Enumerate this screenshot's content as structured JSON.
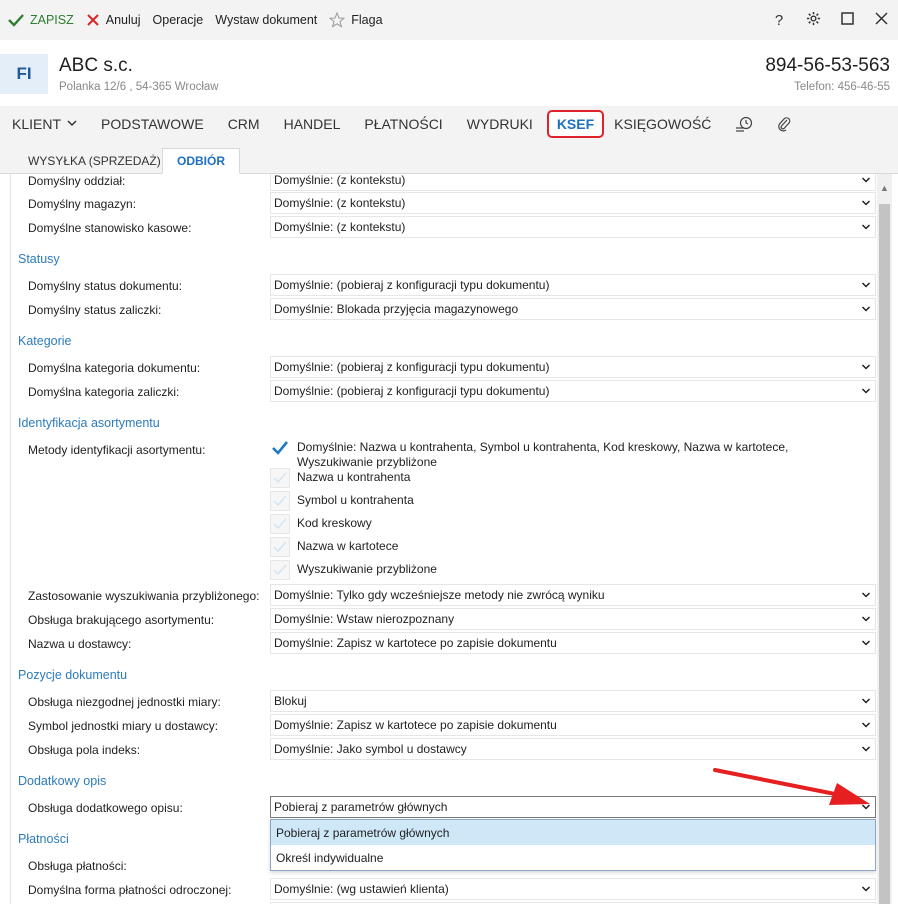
{
  "toolbar": {
    "save_label": "ZAPISZ",
    "cancel_label": "Anuluj",
    "operations_label": "Operacje",
    "issue_label": "Wystaw dokument",
    "flag_label": "Flaga"
  },
  "header": {
    "badge": "FI",
    "company_name": "ABC s.c.",
    "address": "Polanka  12/6 , 54-365 Wrocław",
    "nip": "894-56-53-563",
    "phone": "Telefon: 456-46-55"
  },
  "main_tabs": {
    "klient": "KLIENT",
    "podstawowe": "PODSTAWOWE",
    "crm": "CRM",
    "handel": "HANDEL",
    "platnosci": "PŁATNOŚCI",
    "wydruki": "WYDRUKI",
    "ksef": "KSEF",
    "ksiegowosc": "KSIĘGOWOŚĆ"
  },
  "sub_tabs": {
    "wysylka": "WYSYŁKA (SPRZEDAŻ)",
    "odbior": "ODBIÓR"
  },
  "rows": {
    "oddzial": {
      "label": "Domyślny oddział:",
      "value": "Domyślnie: (z kontekstu)"
    },
    "magazyn": {
      "label": "Domyślny magazyn:",
      "value": "Domyślnie: (z kontekstu)"
    },
    "stanowisko": {
      "label": "Domyślne stanowisko kasowe:",
      "value": "Domyślnie: (z kontekstu)"
    },
    "status_dok": {
      "label": "Domyślny status dokumentu:",
      "value": "Domyślnie: (pobieraj z konfiguracji typu dokumentu)"
    },
    "status_zal": {
      "label": "Domyślny status zaliczki:",
      "value": "Domyślnie: Blokada przyjęcia magazynowego"
    },
    "kat_dok": {
      "label": "Domyślna kategoria dokumentu:",
      "value": "Domyślnie: (pobieraj z konfiguracji typu dokumentu)"
    },
    "kat_zal": {
      "label": "Domyślna kategoria zaliczki:",
      "value": "Domyślnie: (pobieraj z konfiguracji typu dokumentu)"
    },
    "metody": {
      "label": "Metody identyfikacji asortymentu:"
    },
    "wyszuk": {
      "label": "Zastosowanie wyszukiwania przybliżonego:",
      "value": "Domyślnie: Tylko gdy wcześniejsze metody nie zwrócą wyniku"
    },
    "brak": {
      "label": "Obsługa brakującego asortymentu:",
      "value": "Domyślnie: Wstaw nierozpoznany"
    },
    "nazwa_dost": {
      "label": "Nazwa u dostawcy:",
      "value": "Domyślnie: Zapisz w kartotece po zapisie dokumentu"
    },
    "jm": {
      "label": "Obsługa niezgodnej jednostki miary:",
      "value": "Blokuj"
    },
    "symbol_jm": {
      "label": "Symbol jednostki miary u dostawcy:",
      "value": "Domyślnie: Zapisz w kartotece po zapisie dokumentu"
    },
    "indeks": {
      "label": "Obsługa pola indeks:",
      "value": "Domyślnie: Jako symbol u dostawcy"
    },
    "opis": {
      "label": "Obsługa dodatkowego opisu:",
      "value": "Pobieraj z parametrów głównych"
    },
    "platnosci": {
      "label": "Obsługa płatności:"
    },
    "forma": {
      "label": "Domyślna forma płatności odroczonej:",
      "value": "Domyślnie: (wg ustawień klienta)"
    }
  },
  "sections": {
    "statusy": "Statusy",
    "kategorie": "Kategorie",
    "identyfikacja": "Identyfikacja asortymentu",
    "pozycje": "Pozycje dokumentu",
    "opis": "Dodatkowy opis",
    "platnosci": "Płatności"
  },
  "checkboxes": [
    {
      "label": "Domyślnie: Nazwa u kontrahenta, Symbol u kontrahenta, Kod kreskowy, Nazwa w kartotece, Wyszukiwanie przybliżone",
      "checked": true
    },
    {
      "label": "Nazwa u kontrahenta",
      "checked": false
    },
    {
      "label": "Symbol u kontrahenta",
      "checked": false
    },
    {
      "label": "Kod kreskowy",
      "checked": false
    },
    {
      "label": "Nazwa w kartotece",
      "checked": false
    },
    {
      "label": "Wyszukiwanie przybliżone",
      "checked": false
    }
  ],
  "dropdown_options": [
    "Pobieraj z parametrów głównych",
    "Określ indywidualne"
  ],
  "colors": {
    "accent": "#1e6fc0",
    "section": "#2b7bbd",
    "highlight_border": "#e0222d",
    "save_green": "#2f7d32",
    "cancel_red": "#d32f2f",
    "option_highlight": "#cfe8f7",
    "arrow_red": "#e62020"
  }
}
